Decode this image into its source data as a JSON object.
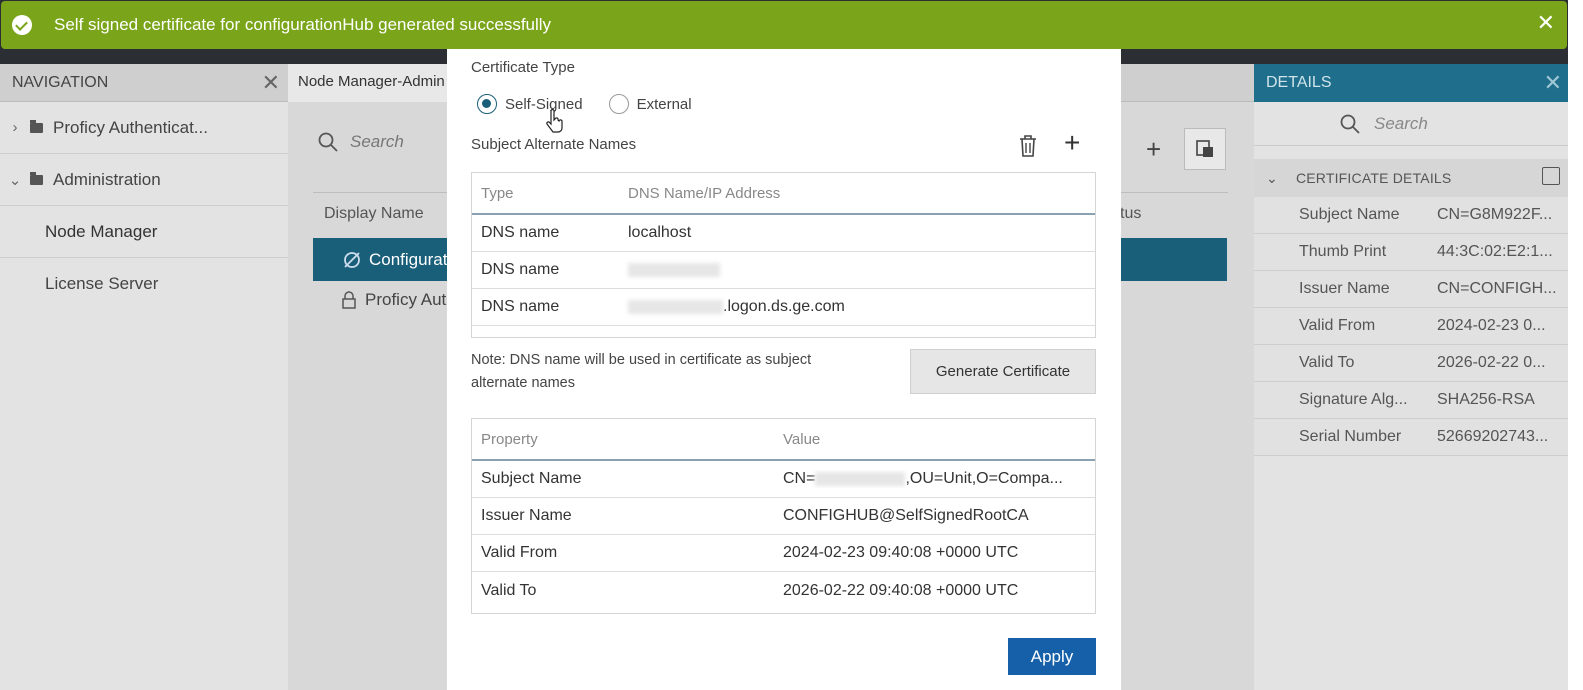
{
  "banner": {
    "message": "Self signed certificate for configurationHub generated successfully",
    "close": "✕"
  },
  "navigation": {
    "title": "NAVIGATION",
    "items": [
      {
        "label": "Proficy Authenticat..."
      },
      {
        "label": "Administration"
      },
      {
        "label": "Node Manager"
      },
      {
        "label": "License Server"
      }
    ]
  },
  "middle": {
    "tab_title": "Node Manager-Admin",
    "search_placeholder": "Search",
    "col_display": "Display Name",
    "col_status": "tus",
    "row_selected": "Configurat",
    "row_second": "Proficy Aut"
  },
  "details": {
    "title": "DETAILS",
    "search_placeholder": "Search",
    "section": "CERTIFICATE DETAILS",
    "rows": [
      {
        "k": "Subject Name",
        "v": "CN=G8M922F..."
      },
      {
        "k": "Thumb Print",
        "v": "44:3C:02:E2:1..."
      },
      {
        "k": "Issuer Name",
        "v": "CN=CONFIGH..."
      },
      {
        "k": "Valid From",
        "v": "2024-02-23 0..."
      },
      {
        "k": "Valid To",
        "v": "2026-02-22 0..."
      },
      {
        "k": "Signature Alg...",
        "v": "SHA256-RSA"
      },
      {
        "k": "Serial Number",
        "v": "52669202743..."
      }
    ]
  },
  "modal": {
    "cert_type_label": "Certificate Type",
    "radio_self": "Self-Signed",
    "radio_external": "External",
    "san_label": "Subject Alternate Names",
    "san_headers": {
      "type": "Type",
      "dns": "DNS Name/IP Address"
    },
    "san_rows": [
      {
        "type": "DNS name",
        "value": "localhost"
      },
      {
        "type": "DNS name",
        "value": ""
      },
      {
        "type": "DNS name",
        "value_suffix": ".logon.ds.ge.com"
      }
    ],
    "note": "Note: DNS name will be used in certificate as subject alternate names",
    "generate_button": "Generate Certificate",
    "prop_headers": {
      "property": "Property",
      "value": "Value"
    },
    "prop_rows": {
      "subject_k": "Subject Name",
      "subject_v_prefix": "CN=",
      "subject_v_suffix": ",OU=Unit,O=Compa...",
      "issuer_k": "Issuer Name",
      "issuer_v": "CONFIGHUB@SelfSignedRootCA",
      "from_k": "Valid From",
      "from_v": "2024-02-23 09:40:08 +0000 UTC",
      "to_k": "Valid To",
      "to_v": "2026-02-22 09:40:08 +0000 UTC"
    },
    "apply_button": "Apply"
  }
}
